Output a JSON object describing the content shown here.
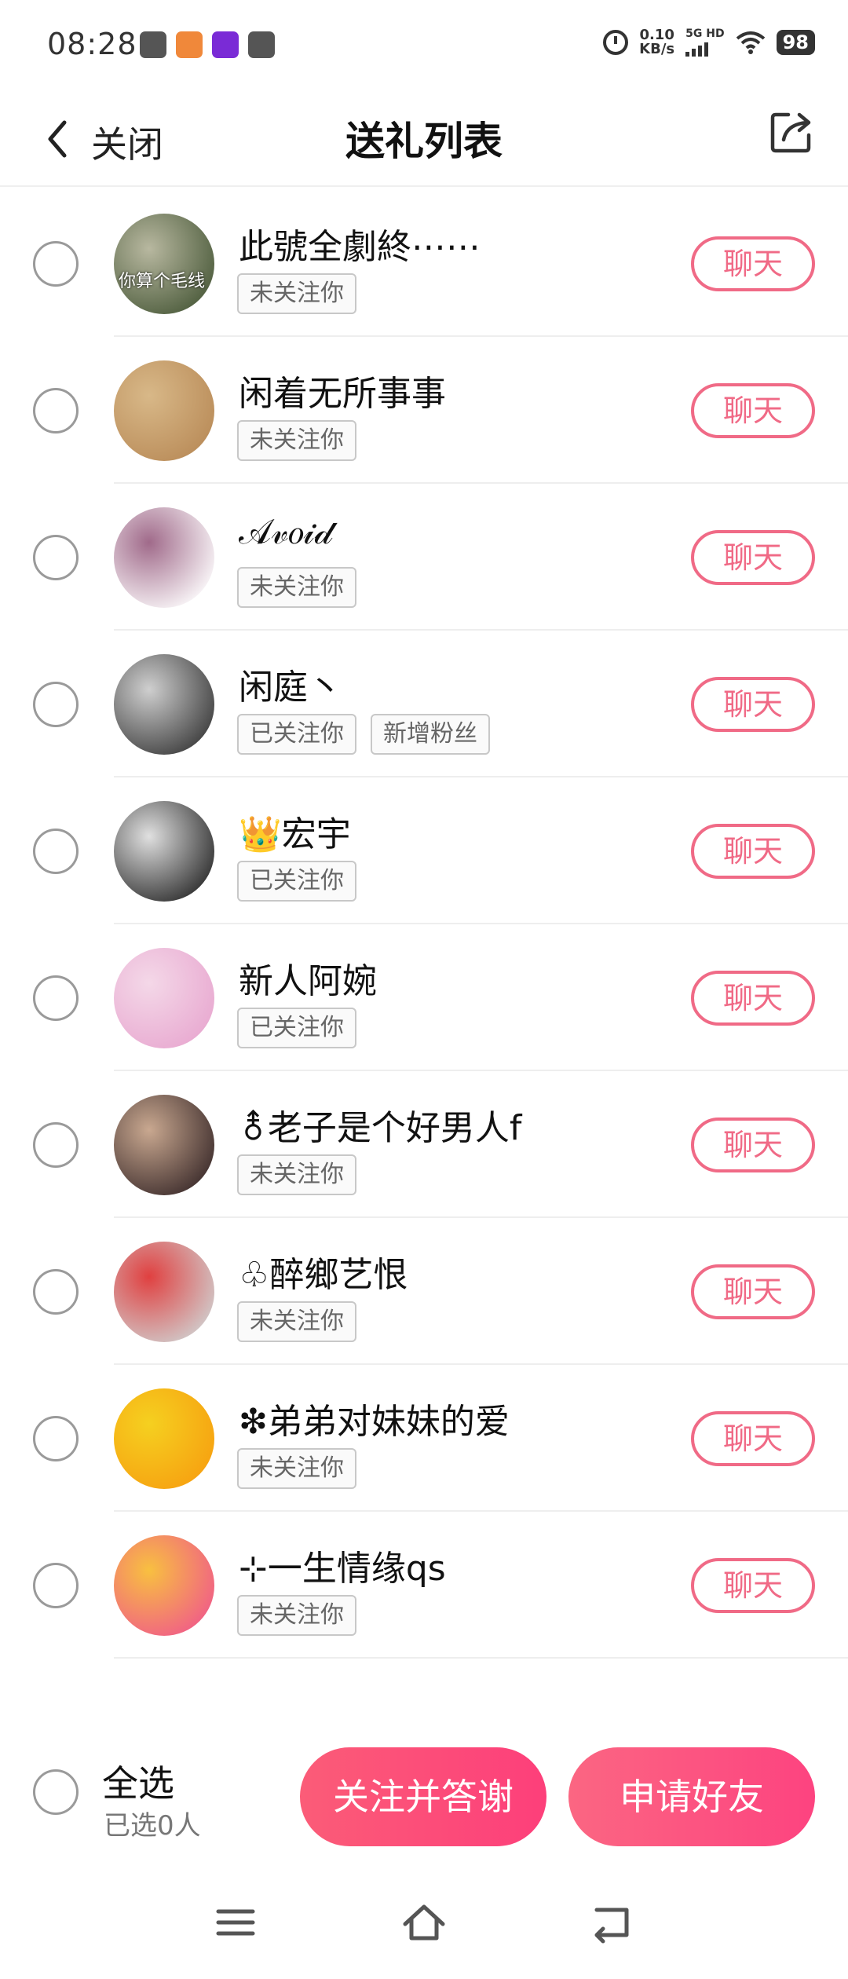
{
  "status_bar": {
    "time": "08:28",
    "net_speed_value": "0.10",
    "net_speed_unit": "KB/s",
    "signal_label": "5G HD",
    "battery": "98",
    "app_icon_colors": [
      "#555555",
      "#f0883a",
      "#7a2bd6",
      "#555555"
    ]
  },
  "header": {
    "back_label": "关闭",
    "title": "送礼列表",
    "back_icon": "chevron-left-icon",
    "share_icon": "share-icon"
  },
  "accent_color": "#f06a86",
  "users": [
    {
      "nickname": "此號全劇終⋯⋯",
      "tags": [
        "未关注你"
      ],
      "chat_label": "聊天",
      "avatar_caption": "你算个毛线",
      "avatar_colors": [
        "#4a5a3a",
        "#b8b8a0"
      ]
    },
    {
      "nickname": "闲着无所事事",
      "tags": [
        "未关注你"
      ],
      "chat_label": "聊天",
      "avatar_colors": [
        "#b98b58",
        "#d8b888"
      ]
    },
    {
      "nickname": "𝒜𝓋𝑜𝒾𝒹",
      "tags": [
        "未关注你"
      ],
      "chat_label": "聊天",
      "avatar_colors": [
        "#ffffff",
        "#a06a8a"
      ]
    },
    {
      "nickname": "闲庭丶",
      "tags": [
        "已关注你",
        "新增粉丝"
      ],
      "chat_label": "聊天",
      "avatar_colors": [
        "#3a3a3a",
        "#cfcfcf"
      ]
    },
    {
      "nickname": "👑宏宇",
      "tags": [
        "已关注你"
      ],
      "chat_label": "聊天",
      "avatar_colors": [
        "#2a2a2a",
        "#e0e0e0"
      ]
    },
    {
      "nickname": "新人阿婉",
      "tags": [
        "已关注你"
      ],
      "chat_label": "聊天",
      "avatar_colors": [
        "#e8a8d0",
        "#f4d8e8"
      ]
    },
    {
      "nickname": "⚨老子是个好男人f",
      "tags": [
        "未关注你"
      ],
      "chat_label": "聊天",
      "avatar_colors": [
        "#3a2a2a",
        "#c9a890"
      ]
    },
    {
      "nickname": "♧醉鄉艺恨",
      "tags": [
        "未关注你"
      ],
      "chat_label": "聊天",
      "avatar_colors": [
        "#d0d0d0",
        "#e04040"
      ]
    },
    {
      "nickname": "❇弟弟对妹妹的爱",
      "tags": [
        "未关注你"
      ],
      "chat_label": "聊天",
      "avatar_colors": [
        "#f7a010",
        "#f5d020"
      ]
    },
    {
      "nickname": "⊹一生情缘qs",
      "tags": [
        "未关注你"
      ],
      "chat_label": "聊天",
      "avatar_colors": [
        "#f05a8a",
        "#f8c040"
      ]
    }
  ],
  "bottom_bar": {
    "select_all_label": "全选",
    "selected_count": "已选0人",
    "follow_button": "关注并答谢",
    "friend_button": "申请好友"
  },
  "nav_bar": {
    "menu_icon": "menu-icon",
    "home_icon": "home-icon",
    "back_icon": "back-arrow-icon"
  }
}
